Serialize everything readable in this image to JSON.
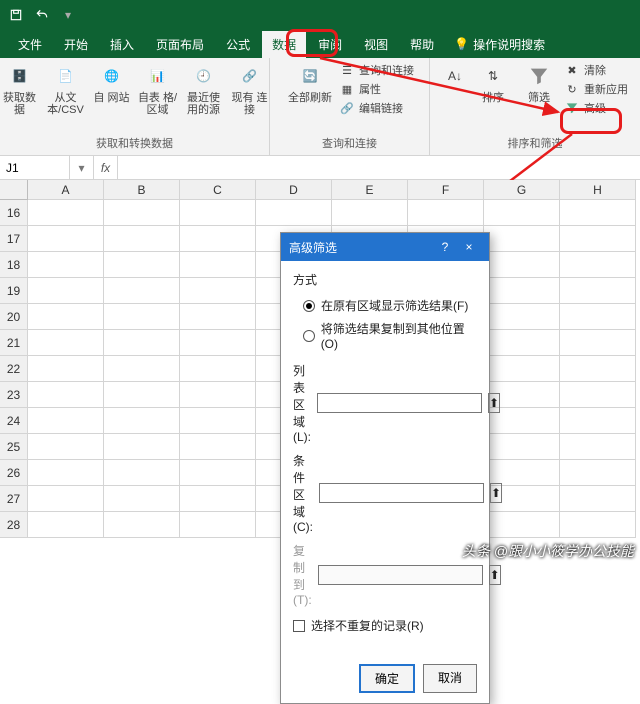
{
  "titlebar": {
    "save_icon": "save",
    "undo_icon": "undo",
    "redo_icon": "redo"
  },
  "menu": {
    "file": "文件",
    "home": "开始",
    "insert": "插入",
    "layout": "页面布局",
    "formula": "公式",
    "data": "数据",
    "review": "审阅",
    "view": "视图",
    "help": "帮助",
    "tellme": "操作说明搜索"
  },
  "ribbon": {
    "group1": {
      "label": "获取和转换数据",
      "btn1": "获取数\n据",
      "btn2": "从文\n本/CSV",
      "btn3": "自\n网站",
      "btn4": "自表\n格/区域",
      "btn5": "最近使\n用的源",
      "btn6": "现有\n连接"
    },
    "group2": {
      "label": "查询和连接",
      "big": "全部刷新",
      "s1": "查询和连接",
      "s2": "属性",
      "s3": "编辑链接"
    },
    "group3": {
      "label": "排序和筛选",
      "sort": "排序",
      "filter": "筛选",
      "clear": "清除",
      "reapply": "重新应用",
      "advanced": "高级"
    }
  },
  "formula_bar": {
    "cell": "J1",
    "fx": "fx"
  },
  "columns": [
    "A",
    "B",
    "C",
    "D",
    "E",
    "F",
    "G",
    "H"
  ],
  "rows": [
    "16",
    "17",
    "18",
    "19",
    "20",
    "21",
    "22",
    "23",
    "24",
    "25",
    "26",
    "27",
    "28"
  ],
  "dialog": {
    "title": "高级筛选",
    "help": "?",
    "close": "×",
    "method": "方式",
    "opt1": "在原有区域显示筛选结果(F)",
    "opt2": "将筛选结果复制到其他位置(O)",
    "list_label": "列表区域(L):",
    "cond_label": "条件区域(C):",
    "copy_label": "复制到(T):",
    "unique": "选择不重复的记录(R)",
    "ok": "确定",
    "cancel": "取消"
  },
  "watermark": "头条 @跟小小筱学办公技能"
}
